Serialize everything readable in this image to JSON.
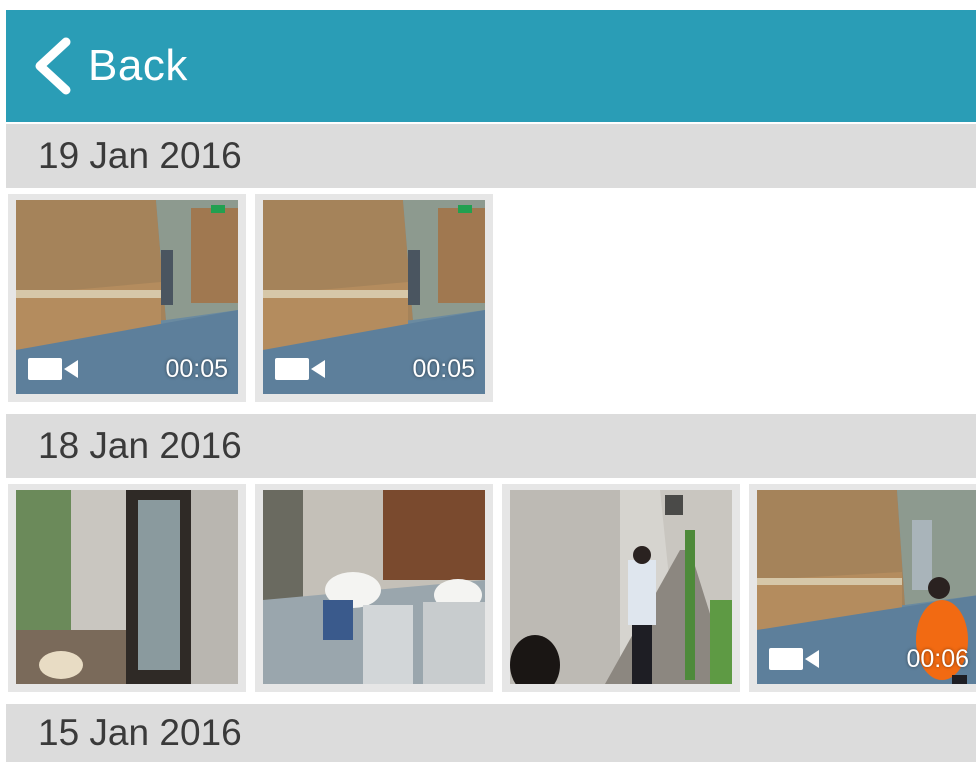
{
  "header": {
    "back_label": "Back",
    "back_icon": "chevron-left-icon",
    "color": "#2a9db6"
  },
  "sections": [
    {
      "date": "19 Jan 2016",
      "items": [
        {
          "type": "video",
          "duration": "00:05",
          "scene": "reception-lobby"
        },
        {
          "type": "video",
          "duration": "00:05",
          "scene": "reception-lobby"
        }
      ]
    },
    {
      "date": "18 Jan 2016",
      "items": [
        {
          "type": "photo",
          "duration": "",
          "scene": "doorway"
        },
        {
          "type": "photo",
          "duration": "",
          "scene": "office-desks"
        },
        {
          "type": "photo",
          "duration": "",
          "scene": "corridor-person"
        },
        {
          "type": "video",
          "duration": "00:06",
          "scene": "lobby-person-orange"
        }
      ]
    },
    {
      "date": "15 Jan 2016",
      "items": []
    }
  ]
}
